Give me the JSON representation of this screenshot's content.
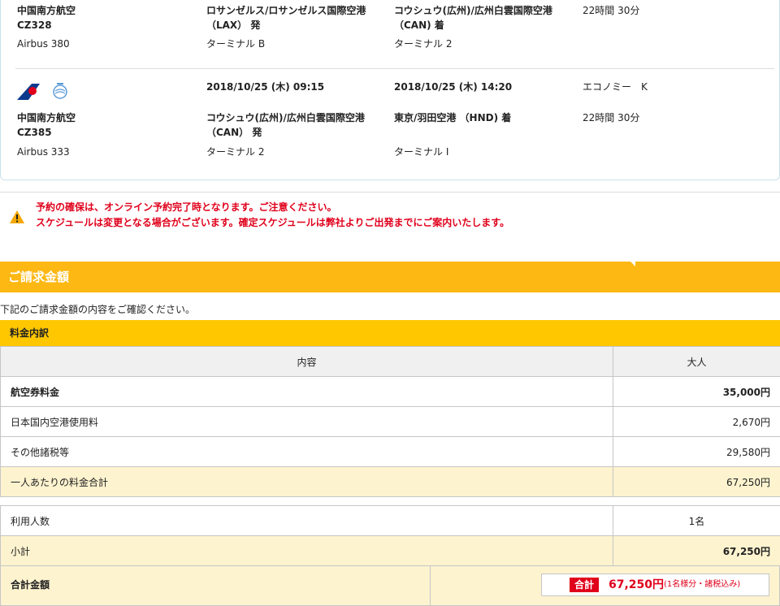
{
  "flights": [
    {
      "airline": "中国南方航空",
      "flight_no": "CZ328",
      "aircraft": "Airbus 380",
      "dep_airport": "ロサンゼルス/ロサンゼルス国際空港",
      "dep_suffix": "（LAX） 発",
      "dep_terminal": "ターミナル B",
      "arr_airport": "コウシュウ(広州)/広州白雲国際空港",
      "arr_suffix": "（CAN) 着",
      "arr_terminal": "ターミナル 2",
      "duration": "22時間 30分"
    },
    {
      "dep_datetime": "2018/10/25 (木) 09:15",
      "arr_datetime": "2018/10/25 (木) 14:20",
      "cabin": "エコノミー　K",
      "airline": "中国南方航空",
      "flight_no": "CZ385",
      "aircraft": "Airbus 333",
      "dep_airport": "コウシュウ(広州)/広州白雲国際空港",
      "dep_suffix": "（CAN） 発",
      "dep_terminal": "ターミナル 2",
      "arr_airport": "東京/羽田空港 （HND) 着",
      "arr_terminal": "ターミナル I",
      "duration": "22時間 30分"
    }
  ],
  "warning": {
    "line1": "予約の確保は、オンライン予約完了時となります。ご注意ください。",
    "line2": "スケジュールは変更となる場合がございます。確定スケジュールは弊社よりご出発までにご案内いたします。"
  },
  "billing": {
    "title": "ご請求金額",
    "description": "下記のご請求金額の内容をご確認ください。",
    "breakdown_title": "料金内訳",
    "col_content": "内容",
    "col_adult": "大人",
    "rows": [
      {
        "label": "航空券料金",
        "value": "35,000円"
      },
      {
        "label": "日本国内空港使用料",
        "value": "2,670円"
      },
      {
        "label": "その他諸税等",
        "value": "29,580円"
      },
      {
        "label": "一人あたりの料金合計",
        "value": "67,250円"
      }
    ],
    "passengers_label": "利用人数",
    "passengers_value": "1名",
    "subtotal_label": "小計",
    "subtotal_value": "67,250円",
    "total_label": "合計金額",
    "total_badge": "合計",
    "total_amount": "67,250円",
    "total_note": "(1名様分・諸税込み)"
  },
  "colors": {
    "accent_yellow": "#fdb813",
    "bar_yellow": "#ffc700",
    "warning_red": "#e0001b",
    "highlight_row": "#fdf3cf"
  }
}
